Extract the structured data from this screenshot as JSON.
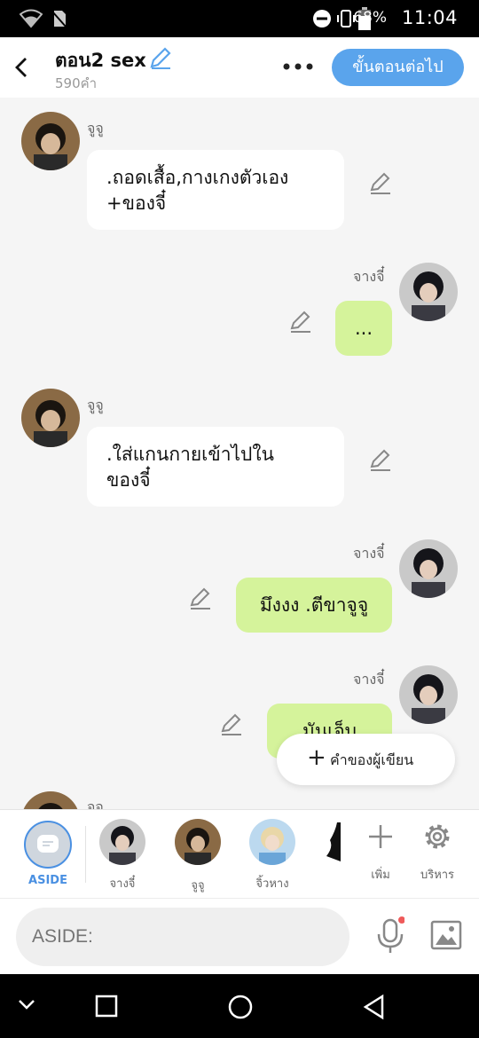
{
  "status_bar": {
    "battery": "68%",
    "time": "11:04"
  },
  "header": {
    "title": "ตอน2 sex",
    "word_count": "590คำ",
    "next_button": "ขั้นตอนต่อไป"
  },
  "messages": [
    {
      "side": "left",
      "name": "จูจู",
      "text": ".ถอดเสื้อ,กางเกงตัวเอง\n+ของจี๋"
    },
    {
      "side": "right",
      "name": "จางจี๋",
      "text": "..."
    },
    {
      "side": "left",
      "name": "จูจู",
      "text": ".ใส่แกนกายเข้าไปใน\nของจี๋"
    },
    {
      "side": "right",
      "name": "จางจี๋",
      "text": "มึงงง .ตีขาจูจู"
    },
    {
      "side": "right",
      "name": "จางจี๋",
      "text": "มันเจ็บบบบ"
    },
    {
      "side": "left",
      "name": "จูจู",
      "text": ""
    }
  ],
  "floating": {
    "label": "คำของผู้เขียน"
  },
  "characters": {
    "aside_label": "ASIDE",
    "items": [
      {
        "label": "จางจี๋"
      },
      {
        "label": "จูจู"
      },
      {
        "label": "จิ้วหาง"
      }
    ],
    "add_label": "เพิ่ม",
    "manage_label": "บริหาร"
  },
  "input": {
    "placeholder": "ASIDE:"
  },
  "colors": {
    "accent": "#5aa4ec",
    "right_bubble": "#d5f39b",
    "aside_active": "#4a90e2"
  }
}
